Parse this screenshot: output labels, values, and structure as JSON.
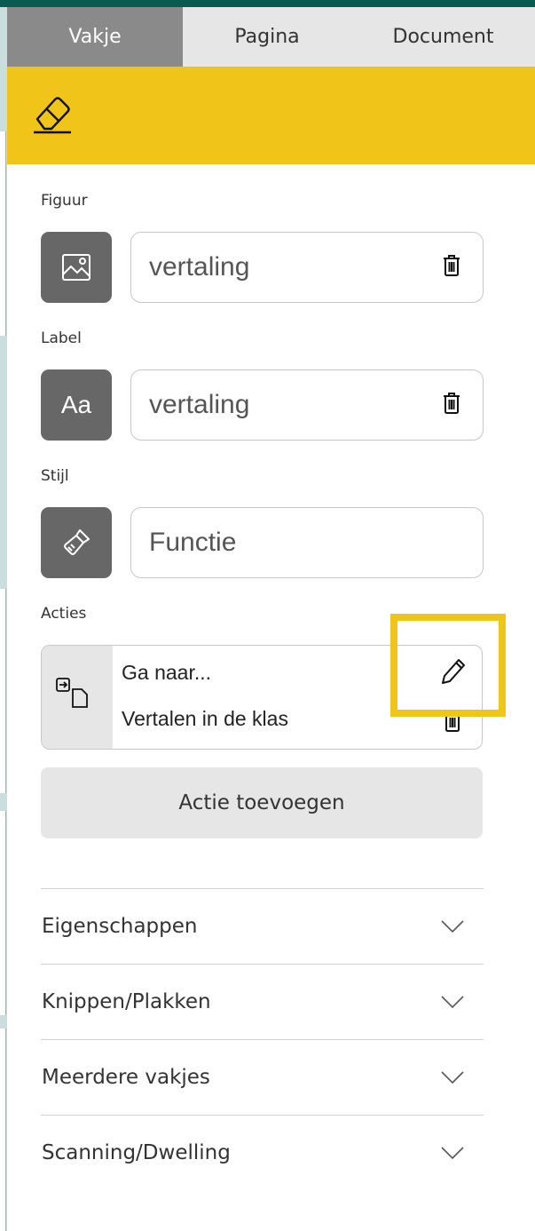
{
  "tabs": [
    {
      "label": "Vakje",
      "active": true
    },
    {
      "label": "Pagina",
      "active": false
    },
    {
      "label": "Document",
      "active": false
    }
  ],
  "banner": {
    "icon": "eraser-icon",
    "color": "#f0c419"
  },
  "figuur": {
    "label": "Figuur",
    "value": "vertaling",
    "icon": "image-icon"
  },
  "labelfield": {
    "label": "Label",
    "value": "vertaling",
    "icon": "text-aa-icon",
    "icon_text": "Aa"
  },
  "stijl": {
    "label": "Stijl",
    "value": "Functie",
    "icon": "paintbrush-icon"
  },
  "acties": {
    "label": "Acties",
    "items": [
      {
        "text": "Ga naar..."
      },
      {
        "text": "Vertalen in de klas"
      }
    ],
    "add_label": "Actie toevoegen"
  },
  "accordion": [
    {
      "label": "Eigenschappen"
    },
    {
      "label": "Knippen/Plakken"
    },
    {
      "label": "Meerdere vakjes"
    },
    {
      "label": "Scanning/Dwelling"
    }
  ],
  "colors": {
    "accent": "#f0c419",
    "frame": "#0b5a52",
    "icon_bg": "#676767"
  }
}
